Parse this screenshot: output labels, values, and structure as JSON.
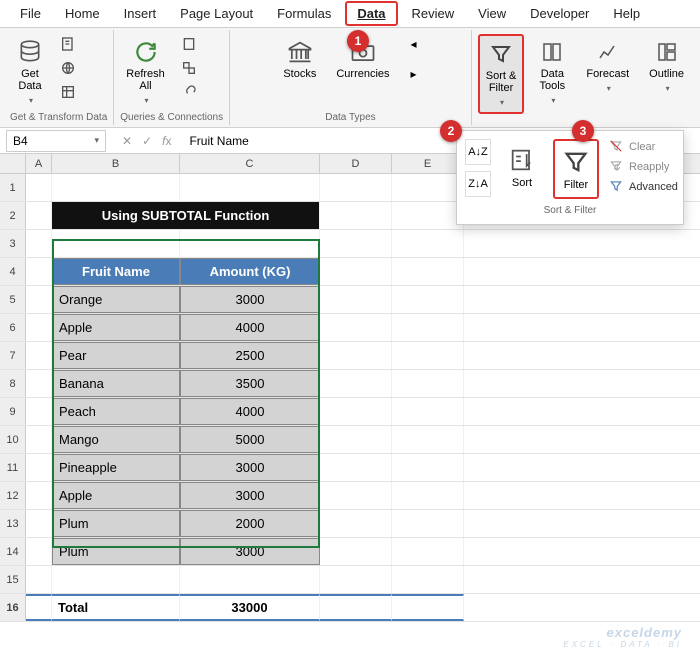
{
  "menu": [
    "File",
    "Home",
    "Insert",
    "Page Layout",
    "Formulas",
    "Data",
    "Review",
    "View",
    "Developer",
    "Help"
  ],
  "active_menu": "Data",
  "ribbon": {
    "group1": {
      "label": "Get & Transform Data",
      "get_data": "Get\nData"
    },
    "group2": {
      "label": "Queries & Connections",
      "refresh": "Refresh\nAll"
    },
    "group3": {
      "label": "Data Types",
      "stocks": "Stocks",
      "currencies": "Currencies"
    },
    "sort_filter": "Sort &\nFilter",
    "data_tools": "Data\nTools",
    "forecast": "Forecast",
    "outline": "Outline"
  },
  "name_box": "B4",
  "formula": "Fruit Name",
  "columns": [
    "A",
    "B",
    "C",
    "D",
    "E"
  ],
  "title": "Using SUBTOTAL Function",
  "headers": {
    "fruit": "Fruit Name",
    "amount": "Amount (KG)"
  },
  "rows": [
    {
      "fruit": "Orange",
      "amount": 3000
    },
    {
      "fruit": "Apple",
      "amount": 4000
    },
    {
      "fruit": "Pear",
      "amount": 2500
    },
    {
      "fruit": "Banana",
      "amount": 3500
    },
    {
      "fruit": "Peach",
      "amount": 4000
    },
    {
      "fruit": "Mango",
      "amount": 5000
    },
    {
      "fruit": "Pineapple",
      "amount": 3000
    },
    {
      "fruit": "Apple",
      "amount": 3000
    },
    {
      "fruit": "Plum",
      "amount": 2000
    },
    {
      "fruit": "Plum",
      "amount": 3000
    }
  ],
  "total": {
    "label": "Total",
    "value": 33000
  },
  "dropdown": {
    "sort": "Sort",
    "filter": "Filter",
    "clear": "Clear",
    "reapply": "Reapply",
    "advanced": "Advanced",
    "label": "Sort & Filter"
  },
  "badges": [
    "1",
    "2",
    "3"
  ],
  "watermark": {
    "main": "exceldemy",
    "sub": "EXCEL · DATA · BI"
  }
}
